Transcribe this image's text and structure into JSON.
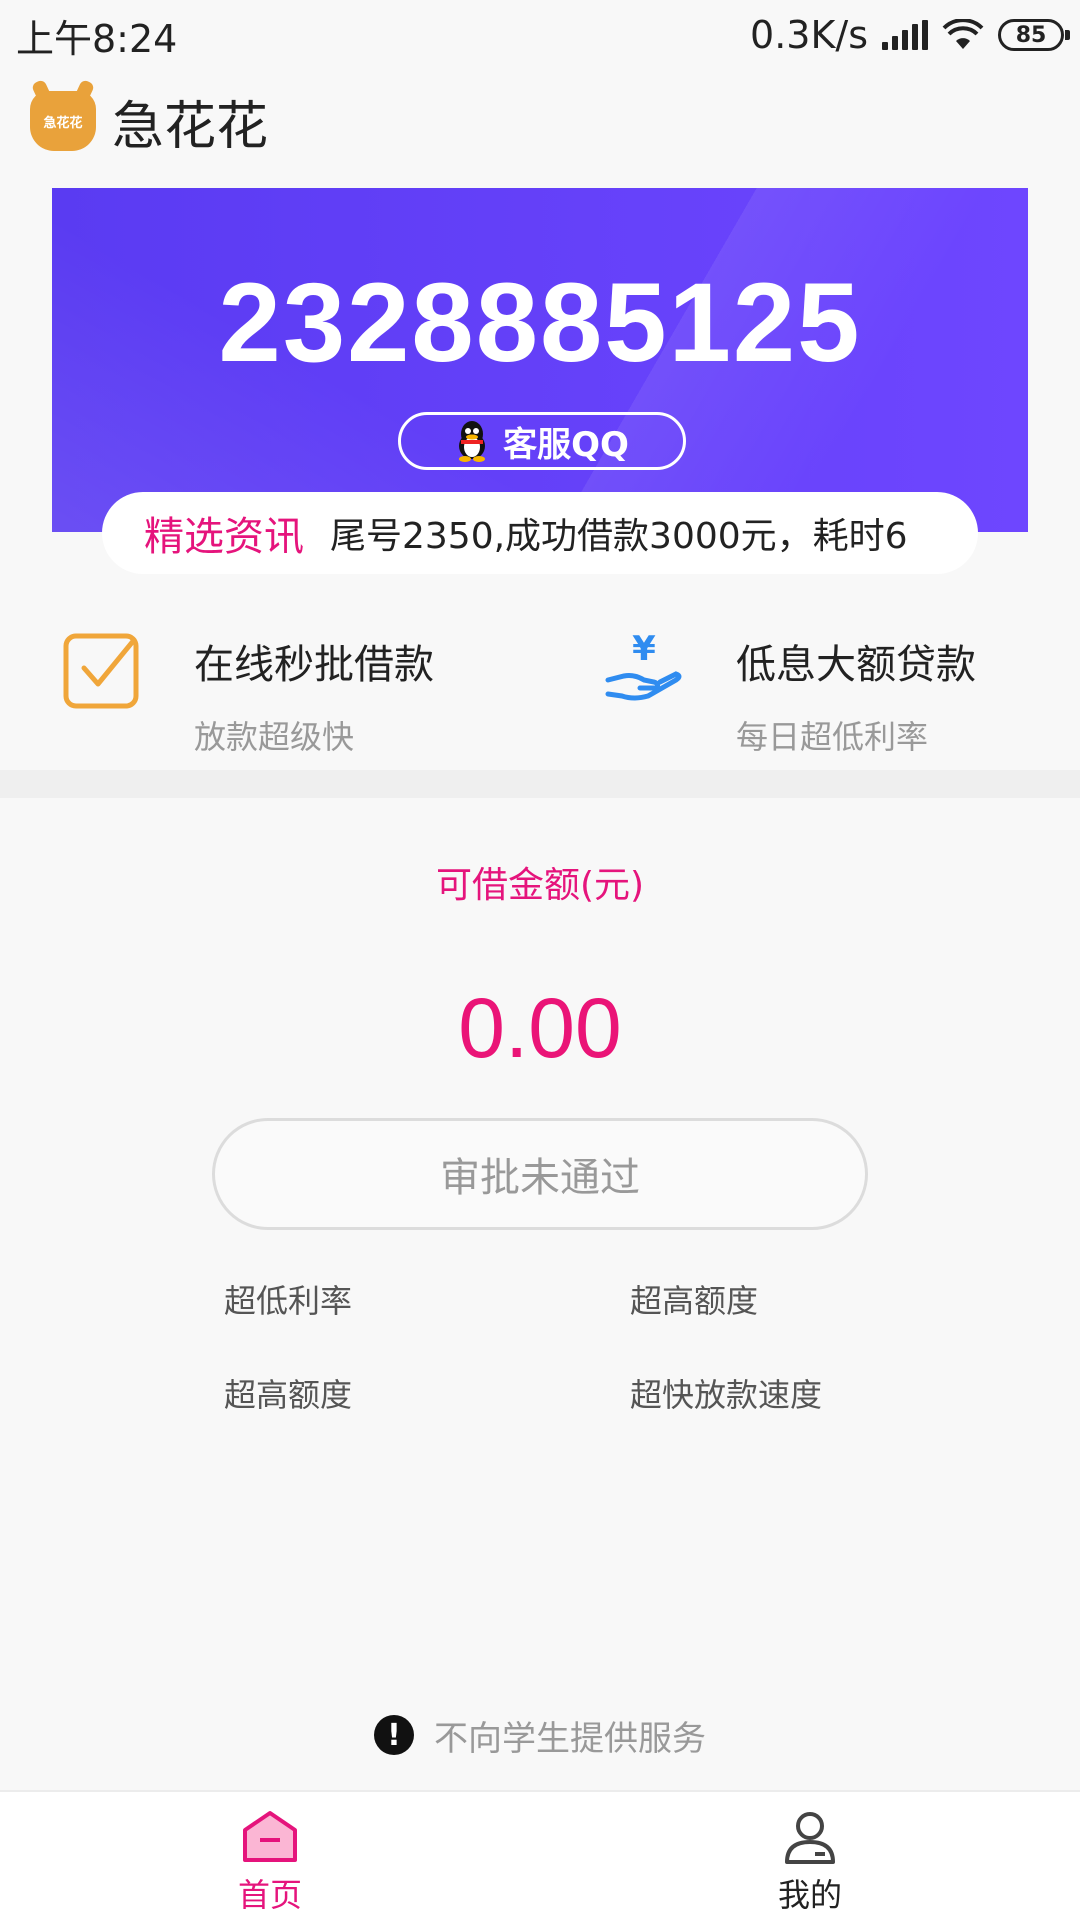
{
  "status_bar": {
    "time": "上午8:24",
    "network_speed": "0.3K/s",
    "battery": "85"
  },
  "header": {
    "logo_text": "急花花",
    "title": "急花花"
  },
  "banner": {
    "number": "2328885125",
    "qq_button_label": "客服QQ",
    "bg_color": "#6a3ef7"
  },
  "ticker": {
    "tag": "精选资讯",
    "text": "尾号2350,成功借款3000元，耗时6"
  },
  "features": [
    {
      "icon": "checkbox-icon",
      "title": "在线秒批借款",
      "subtitle": "放款超级快"
    },
    {
      "icon": "yen-hand-icon",
      "title": "低息大额贷款",
      "subtitle": "每日超低利率"
    }
  ],
  "main": {
    "amount_label": "可借金额(元)",
    "amount_value": "0.00",
    "approval_button": "审批未通过",
    "perks": [
      "超低利率",
      "超高额度",
      "超高额度",
      "超快放款速度"
    ],
    "accent_color": "#e5147c"
  },
  "notice": {
    "text": "不向学生提供服务"
  },
  "bottom_nav": {
    "items": [
      {
        "label": "首页",
        "icon": "home-icon",
        "active": true
      },
      {
        "label": "我的",
        "icon": "user-icon",
        "active": false
      }
    ]
  }
}
